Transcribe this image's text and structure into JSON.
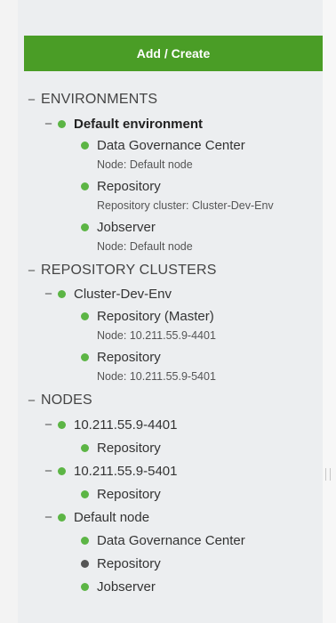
{
  "toolbar": {
    "add_label": "Add / Create"
  },
  "colors": {
    "accent": "#4a9d26",
    "status_ok": "#5cb545",
    "status_off": "#555555"
  },
  "tree": {
    "environments": {
      "label": "ENVIRONMENTS",
      "default_env": {
        "label": "Default environment",
        "dgc": {
          "label": "Data Governance Center",
          "sub": "Node: Default node"
        },
        "repo": {
          "label": "Repository",
          "sub": "Repository cluster: Cluster-Dev-Env"
        },
        "jobserver": {
          "label": "Jobserver",
          "sub": "Node: Default node"
        }
      }
    },
    "clusters": {
      "label": "REPOSITORY CLUSTERS",
      "cluster": {
        "label": "Cluster-Dev-Env",
        "master": {
          "label": "Repository (Master)",
          "sub": "Node: 10.211.55.9-4401"
        },
        "repo2": {
          "label": "Repository",
          "sub": "Node: 10.211.55.9-5401"
        }
      }
    },
    "nodes": {
      "label": "NODES",
      "n4401": {
        "label": "10.211.55.9-4401",
        "repo": {
          "label": "Repository"
        }
      },
      "n5401": {
        "label": "10.211.55.9-5401",
        "repo": {
          "label": "Repository"
        }
      },
      "default": {
        "label": "Default node",
        "dgc": {
          "label": "Data Governance Center"
        },
        "repo": {
          "label": "Repository",
          "status": "stopped"
        },
        "jobserver": {
          "label": "Jobserver"
        }
      }
    }
  }
}
